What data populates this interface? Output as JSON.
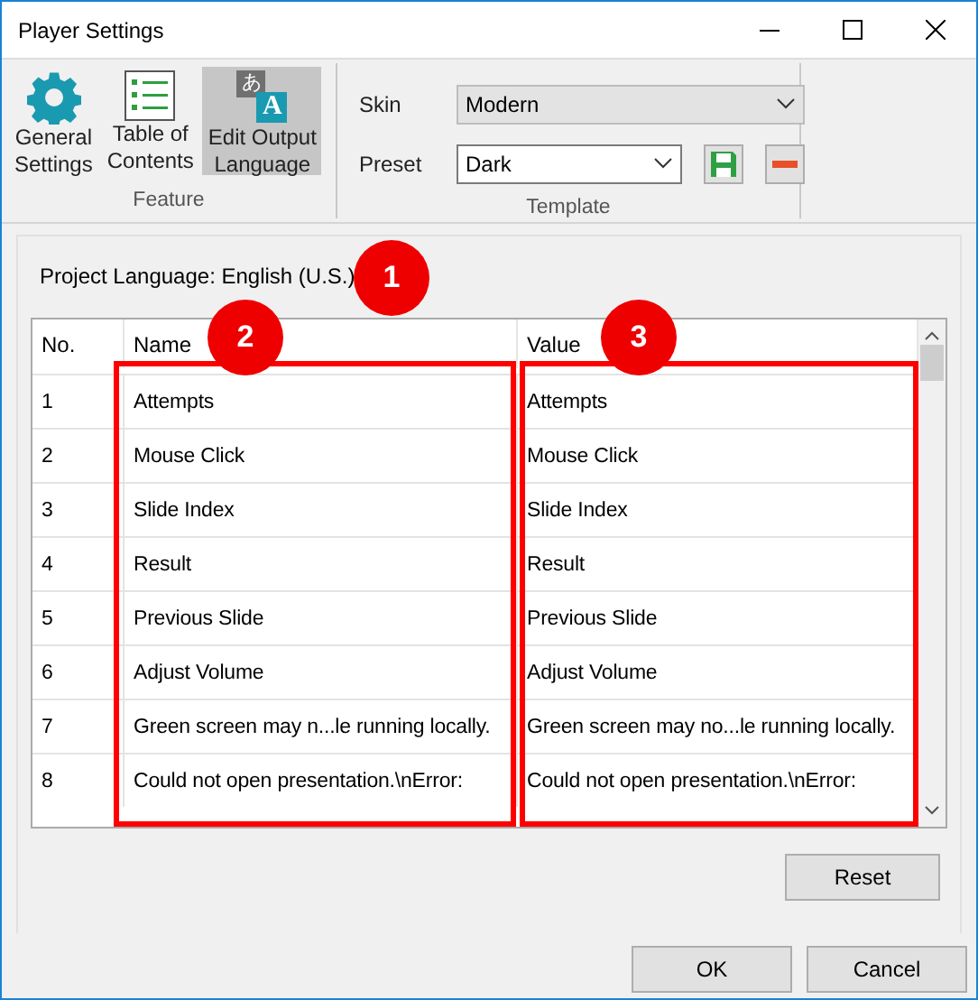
{
  "window": {
    "title": "Player Settings"
  },
  "feature_group": {
    "label": "Feature",
    "items": [
      {
        "kind": "gear",
        "label": [
          "General",
          "Settings"
        ],
        "selected": false
      },
      {
        "kind": "list",
        "label": [
          "Table of",
          "Contents"
        ],
        "selected": false
      },
      {
        "kind": "language",
        "label": [
          "Edit Output",
          "Language"
        ],
        "selected": true,
        "icon_text": [
          "あ",
          "A"
        ]
      }
    ]
  },
  "template_group": {
    "label": "Template",
    "skin": {
      "label": "Skin",
      "value": "Modern",
      "disabled": true
    },
    "preset": {
      "label": "Preset",
      "value": "Dark",
      "disabled": false
    }
  },
  "project_language": "Project Language: English (U.S.)",
  "table": {
    "columns": [
      "No.",
      "Name",
      "Value"
    ],
    "rows": [
      {
        "no": "1",
        "name": "Attempts",
        "value": "Attempts"
      },
      {
        "no": "2",
        "name": "Mouse Click",
        "value": "Mouse Click"
      },
      {
        "no": "3",
        "name": "Slide Index",
        "value": "Slide Index"
      },
      {
        "no": "4",
        "name": "Result",
        "value": "Result"
      },
      {
        "no": "5",
        "name": "Previous Slide",
        "value": "Previous Slide"
      },
      {
        "no": "6",
        "name": "Adjust Volume",
        "value": "Adjust Volume"
      },
      {
        "no": "7",
        "name": "Green screen may n...le running locally.",
        "value": "Green screen may no...le running locally."
      },
      {
        "no": "8",
        "name": "Could not open presentation.\\nError:",
        "value": "Could not open presentation.\\nError:"
      }
    ]
  },
  "callouts": [
    "1",
    "2",
    "3"
  ],
  "buttons": {
    "reset": "Reset",
    "ok": "OK",
    "cancel": "Cancel"
  }
}
